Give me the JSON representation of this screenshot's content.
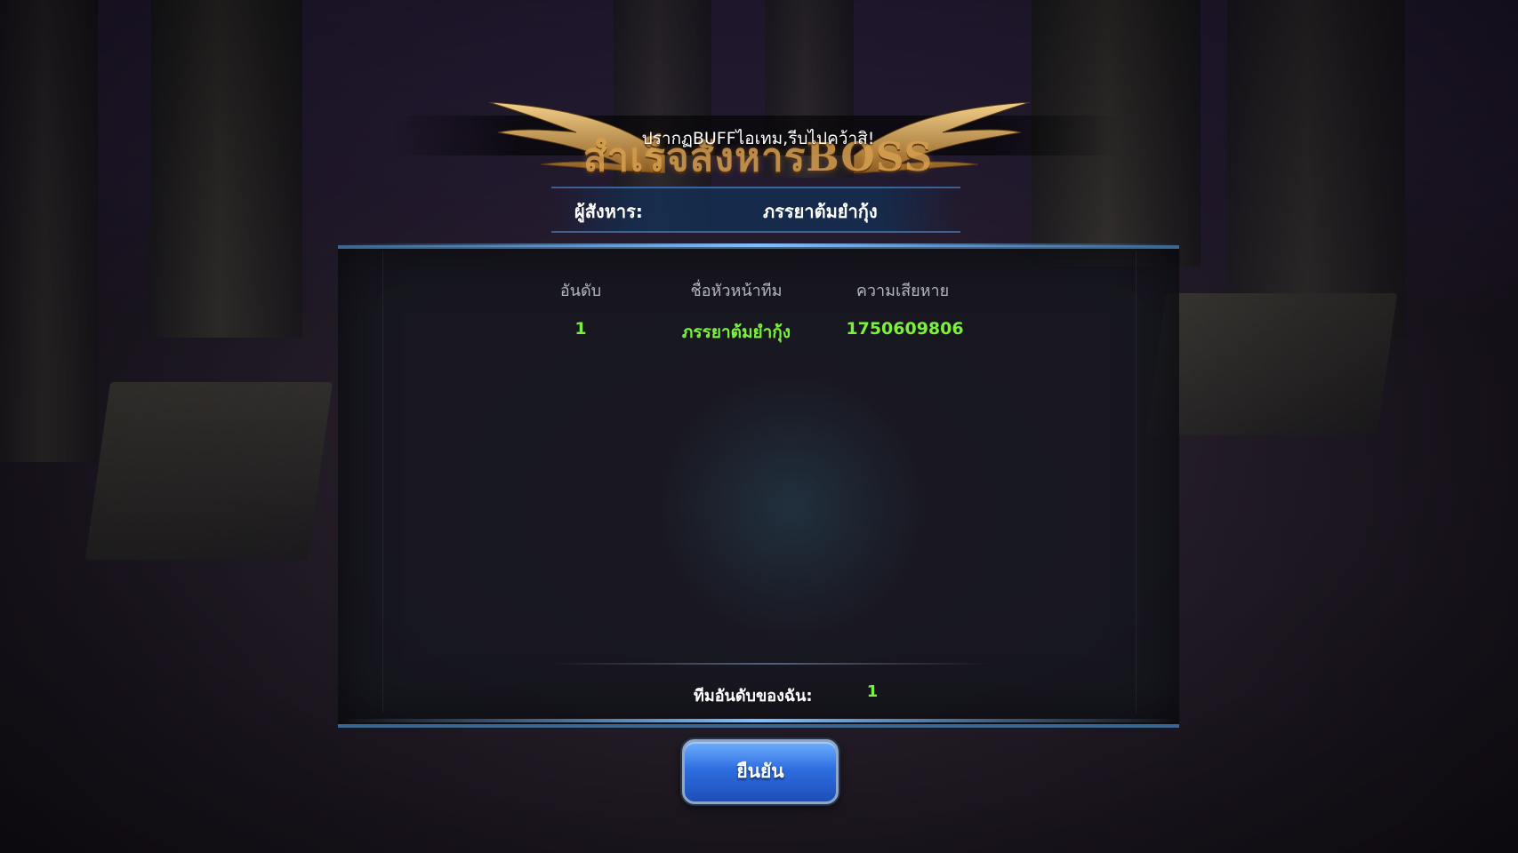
{
  "title": {
    "main": "สำเร็จสังหารBOSS",
    "sub": "ปรากฏBUFFไอเทม,รีบไปคว้าสิ!"
  },
  "killer": {
    "label": "ผู้สังหาร:",
    "name": "ภรรยาต้มยำกุ้ง"
  },
  "ranking": {
    "columns": [
      "อันดับ",
      "ชื่อหัวหน้าทีม",
      "ความเสียหาย"
    ],
    "rows": [
      {
        "rank": "1",
        "leader": "ภรรยาต้มยำกุ้ง",
        "damage": "1750609806"
      }
    ]
  },
  "my_rank": {
    "label": "ทีมอันดับของฉัน:",
    "value": "1"
  },
  "confirm_label": "ยืนยัน",
  "colors": {
    "highlight_green": "#7cf03c",
    "gold_title": "#d8a050",
    "button_blue": "#2f6ee0"
  }
}
